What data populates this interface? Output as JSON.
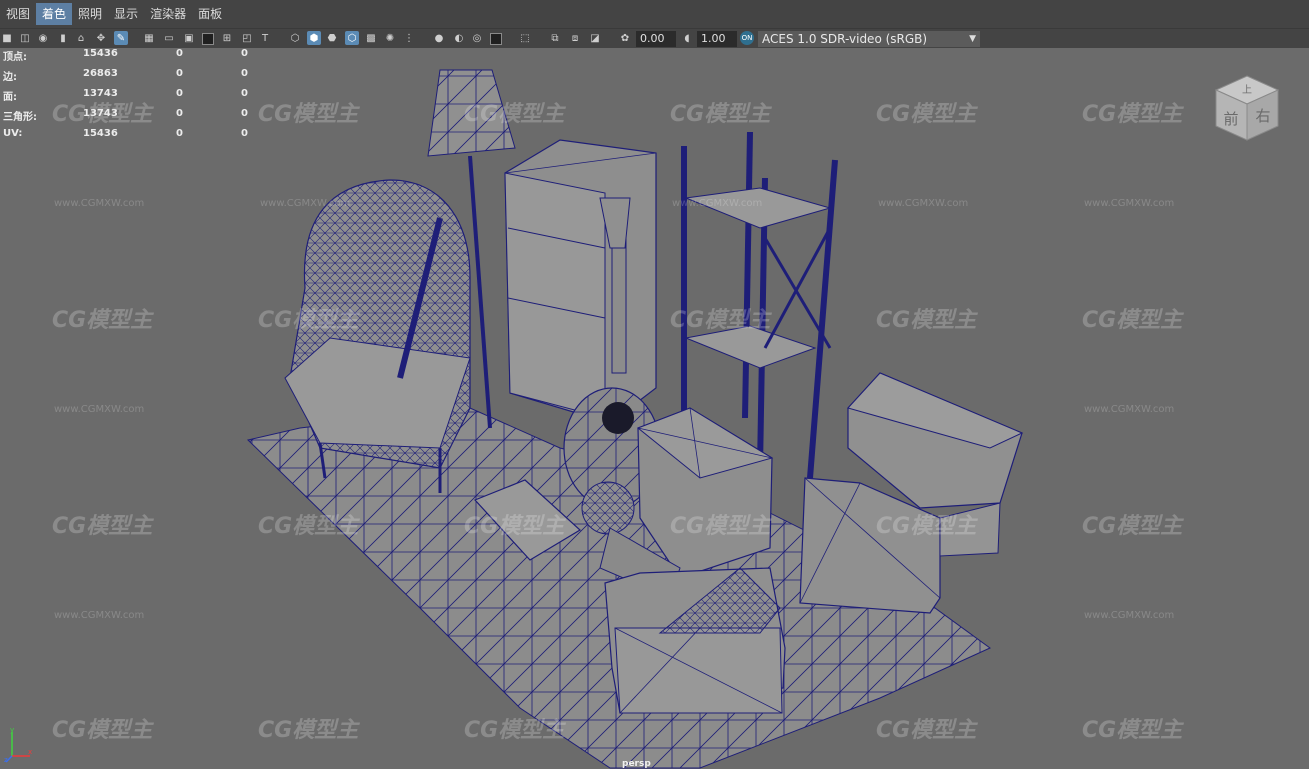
{
  "menu": {
    "items": [
      "视图",
      "着色",
      "照明",
      "显示",
      "渲染器",
      "面板"
    ],
    "active_index": 1
  },
  "toolbar": {
    "exposure_value": "0.00",
    "gamma_value": "1.00",
    "color_space_icon_label": "ON",
    "color_space": "ACES 1.0 SDR-video (sRGB)"
  },
  "hud": {
    "rows": [
      {
        "label": "顶点:",
        "v1": "15436",
        "v2": "0",
        "v3": "0"
      },
      {
        "label": "边:",
        "v1": "26863",
        "v2": "0",
        "v3": "0"
      },
      {
        "label": "面:",
        "v1": "13743",
        "v2": "0",
        "v3": "0"
      },
      {
        "label": "三角形:",
        "v1": "13743",
        "v2": "0",
        "v3": "0"
      },
      {
        "label": "UV:",
        "v1": "15436",
        "v2": "0",
        "v3": "0"
      }
    ]
  },
  "viewcube": {
    "top": "上",
    "front": "前",
    "right": "右"
  },
  "camera_label": "persp",
  "watermark": {
    "logo_text": "CG模型主",
    "url": "www.CGMXW.com"
  },
  "axis": {
    "x": "x",
    "y": "y",
    "z": "z"
  },
  "colors": {
    "wire": "#1e1e78",
    "mesh_fill": "#8a8a8a",
    "viewport_bg": "#6b6b6b",
    "menu_active": "#5d7fa3"
  }
}
